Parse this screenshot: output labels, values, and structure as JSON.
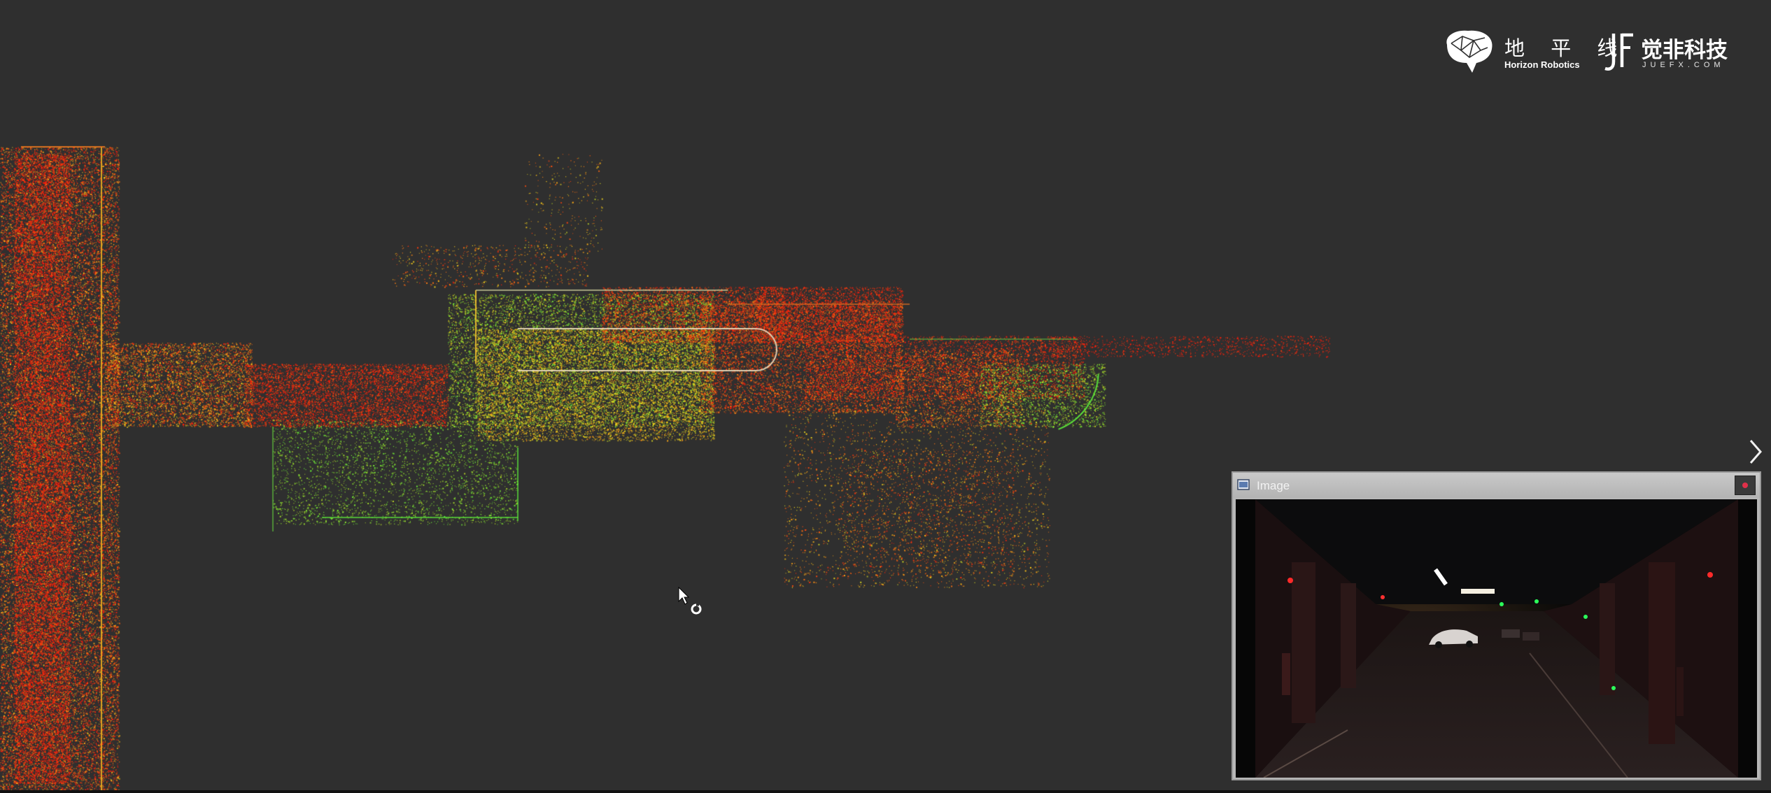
{
  "logos": {
    "horizon": {
      "cn": "地 平 线",
      "en": "Horizon Robotics",
      "icon": "brain-icon"
    },
    "juefx": {
      "cn": "觉非科技",
      "en": "JUEFX.COM",
      "icon": "jf-monogram-icon"
    }
  },
  "map": {
    "description_icon": "point-cloud-map",
    "colors": {
      "background": "#2f2f2f",
      "high": "#ff1a0a",
      "mid": "#ffd21a",
      "low": "#5ef03a"
    }
  },
  "navigation": {
    "next_icon": "chevron-right-icon"
  },
  "image_window": {
    "title": "Image",
    "icon": "window-app-icon",
    "close_icon": "close-icon"
  },
  "cursor": {
    "icon": "busy-cursor-icon"
  }
}
